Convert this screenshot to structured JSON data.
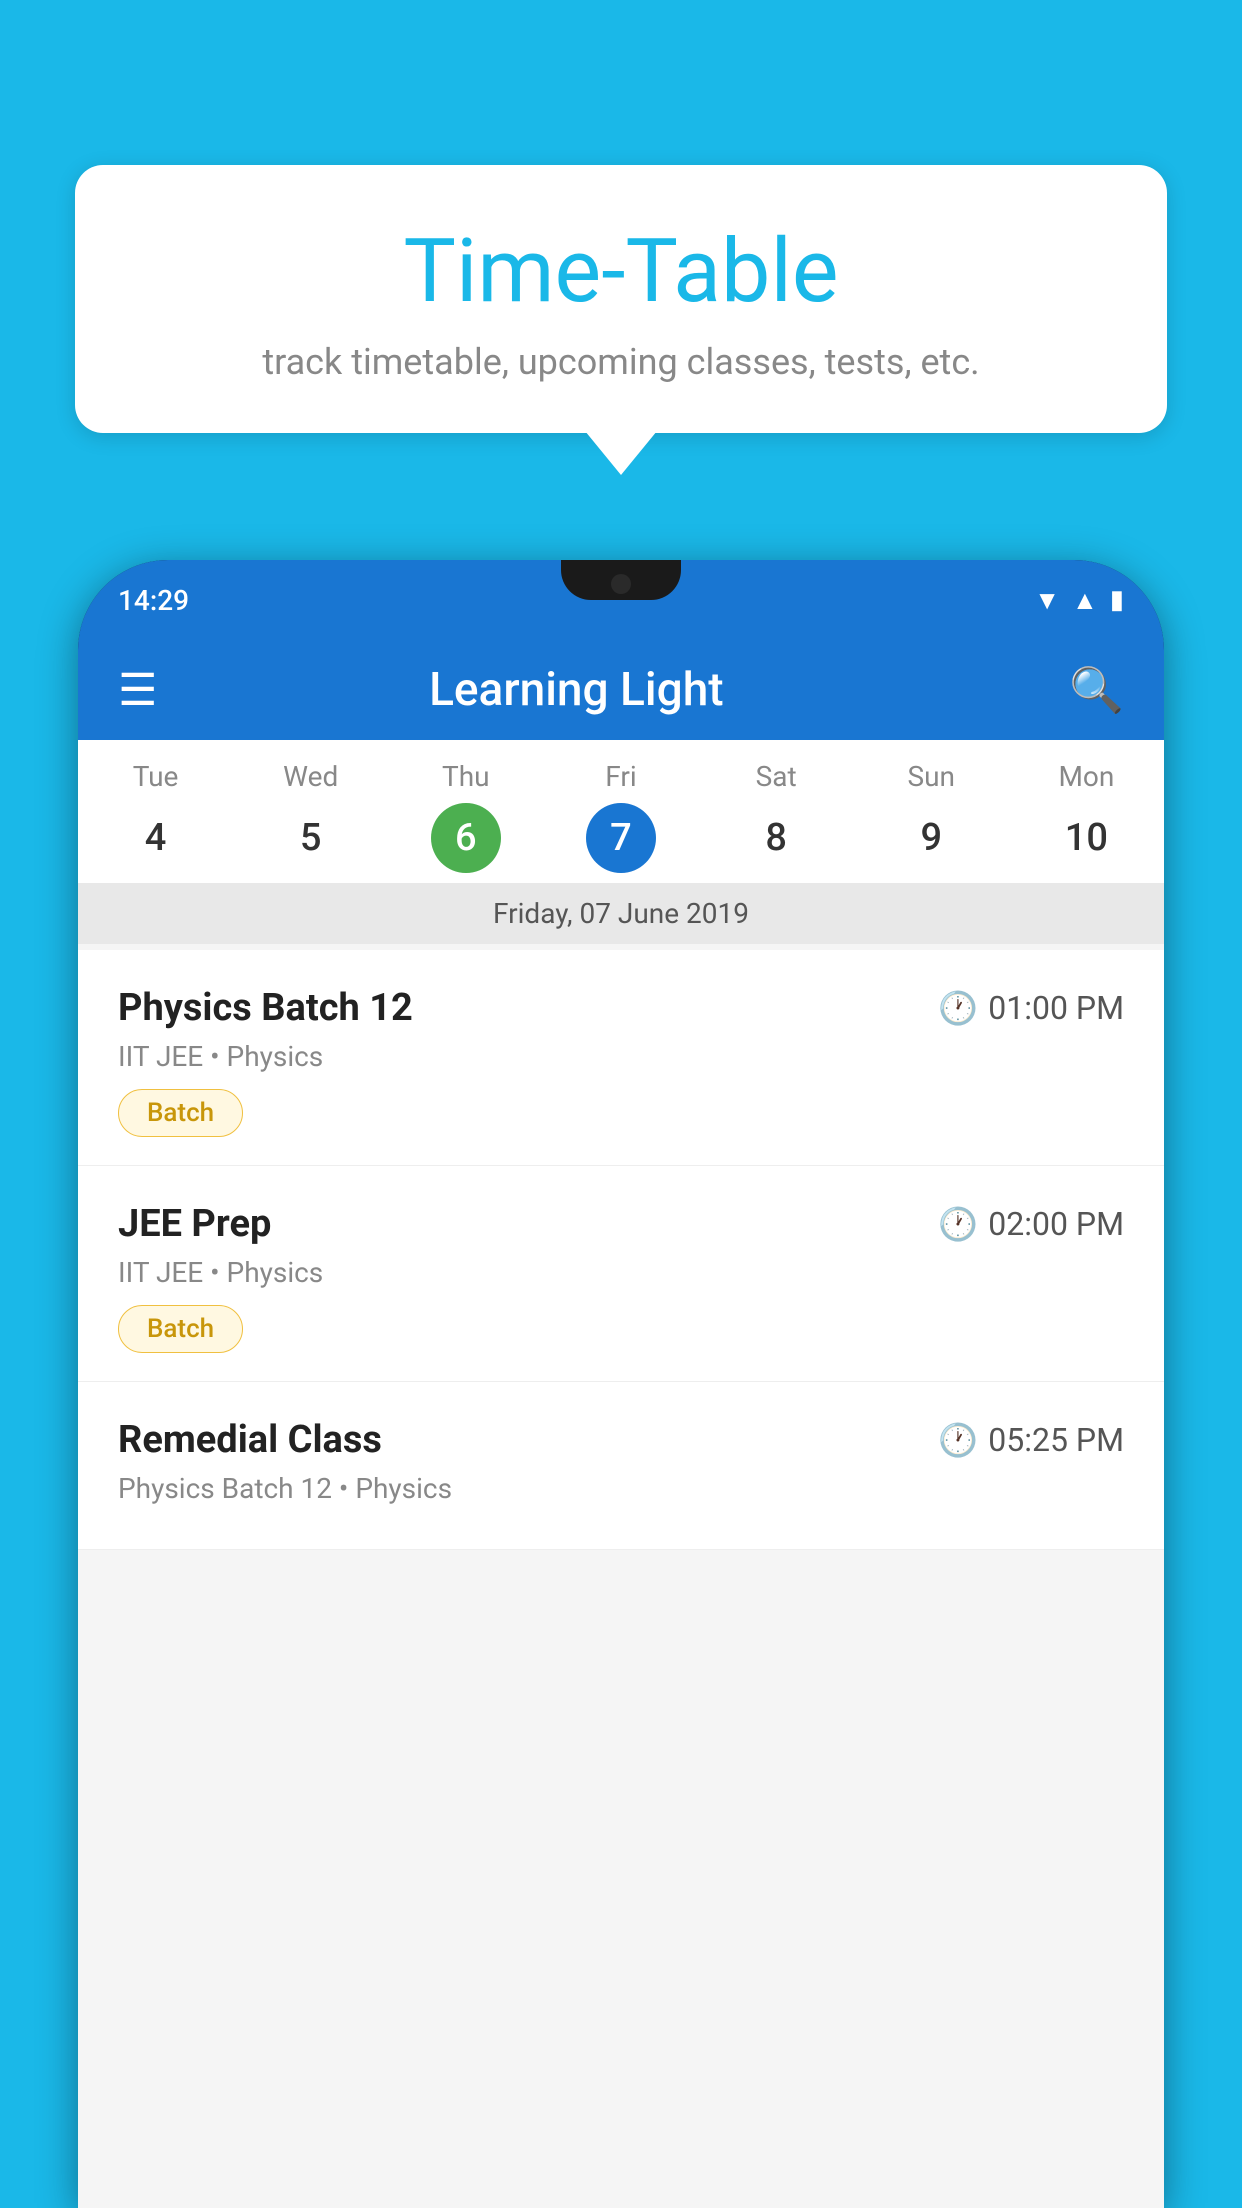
{
  "background": {
    "color": "#1ab8e8"
  },
  "tooltip": {
    "title": "Time-Table",
    "subtitle": "track timetable, upcoming classes, tests, etc."
  },
  "phone": {
    "status_bar": {
      "time": "14:29"
    },
    "app_bar": {
      "title": "Learning Light"
    },
    "calendar": {
      "selected_date_label": "Friday, 07 June 2019",
      "days": [
        {
          "label": "Tue",
          "num": "4",
          "state": "normal"
        },
        {
          "label": "Wed",
          "num": "5",
          "state": "normal"
        },
        {
          "label": "Thu",
          "num": "6",
          "state": "today"
        },
        {
          "label": "Fri",
          "num": "7",
          "state": "selected"
        },
        {
          "label": "Sat",
          "num": "8",
          "state": "normal"
        },
        {
          "label": "Sun",
          "num": "9",
          "state": "normal"
        },
        {
          "label": "Mon",
          "num": "10",
          "state": "normal"
        }
      ]
    },
    "schedule": [
      {
        "title": "Physics Batch 12",
        "time": "01:00 PM",
        "meta": "IIT JEE • Physics",
        "badge": "Batch"
      },
      {
        "title": "JEE Prep",
        "time": "02:00 PM",
        "meta": "IIT JEE • Physics",
        "badge": "Batch"
      },
      {
        "title": "Remedial Class",
        "time": "05:25 PM",
        "meta": "Physics Batch 12 • Physics",
        "badge": null
      }
    ]
  }
}
